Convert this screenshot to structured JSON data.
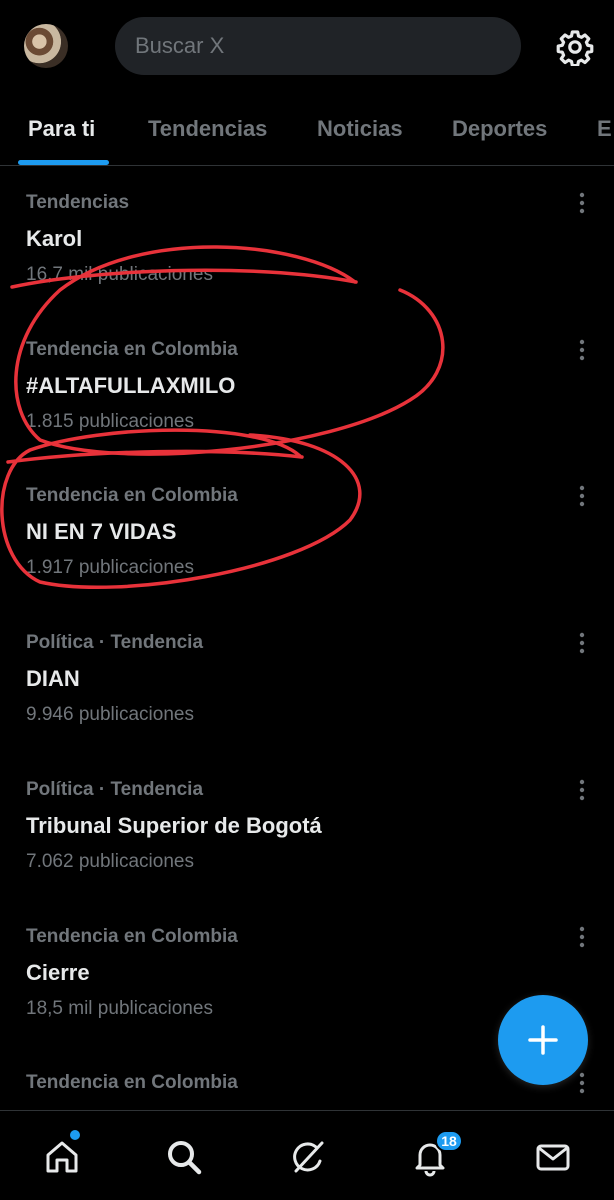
{
  "search": {
    "placeholder": "Buscar X"
  },
  "tabs": [
    {
      "label": "Para ti"
    },
    {
      "label": "Tendencias"
    },
    {
      "label": "Noticias"
    },
    {
      "label": "Deportes"
    },
    {
      "label": "E"
    }
  ],
  "trends": [
    {
      "meta": "Tendencias",
      "name": "Karol",
      "count": "16,7 mil publicaciones"
    },
    {
      "meta": "Tendencia en Colombia",
      "name": "#ALTAFULLAXMILO",
      "count": "1.815 publicaciones"
    },
    {
      "meta": "Tendencia en Colombia",
      "name": "NI EN 7 VIDAS",
      "count": "1.917 publicaciones"
    },
    {
      "meta": "Política · Tendencia",
      "name": "DIAN",
      "count": "9.946 publicaciones"
    },
    {
      "meta": "Política · Tendencia",
      "name": "Tribunal Superior de Bogotá",
      "count": "7.062 publicaciones"
    },
    {
      "meta": "Tendencia en Colombia",
      "name": "Cierre",
      "count": "18,5 mil publicaciones"
    },
    {
      "meta": "Tendencia en Colombia",
      "name": "",
      "count": ""
    }
  ],
  "notifications": {
    "badge": "18"
  },
  "colors": {
    "accent": "#1d9bf0",
    "annotation": "#e8323a",
    "background": "#000000"
  },
  "icons": [
    "gear-icon",
    "more-icon",
    "plus-icon",
    "home-icon",
    "search-icon",
    "grok-icon",
    "bell-icon",
    "mail-icon"
  ]
}
